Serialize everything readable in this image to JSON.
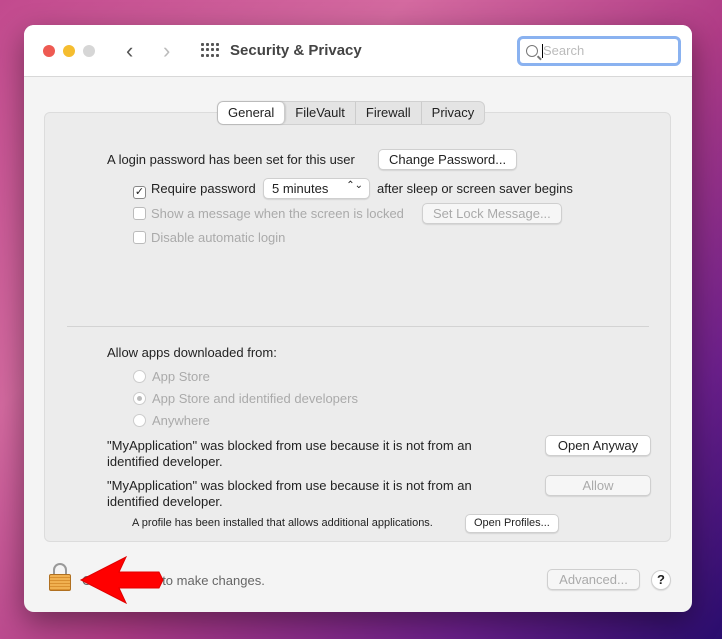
{
  "window": {
    "title": "Security & Privacy",
    "search_placeholder": "Search"
  },
  "tabs": [
    {
      "label": "General",
      "active": true
    },
    {
      "label": "FileVault"
    },
    {
      "label": "Firewall"
    },
    {
      "label": "Privacy"
    }
  ],
  "general": {
    "login_text": "A login password has been set for this user",
    "change_password": "Change Password...",
    "require_password": {
      "label": "Require password",
      "checked": true,
      "value": "5 minutes",
      "suffix": "after sleep or screen saver begins"
    },
    "show_message": {
      "label": "Show a message when the screen is locked",
      "checked": false,
      "button": "Set Lock Message..."
    },
    "disable_login": {
      "label": "Disable automatic login",
      "checked": false
    },
    "allow_apps_label": "Allow apps downloaded from:",
    "radios": [
      {
        "label": "App Store",
        "selected": false
      },
      {
        "label": "App Store and identified developers",
        "selected": true
      },
      {
        "label": "Anywhere",
        "selected": false
      }
    ],
    "blocked1": {
      "line1": "\"MyApplication\" was blocked from use because it is not from an",
      "line2": "identified developer.",
      "button": "Open Anyway"
    },
    "blocked2": {
      "line1": "\"MyApplication\" was blocked from use because it is not from an",
      "line2": "identified developer.",
      "button": "Allow"
    },
    "profile_text": "A profile has been installed that allows additional applications.",
    "open_profiles": "Open Profiles..."
  },
  "footer": {
    "lock_text": "Click the lock to make changes.",
    "advanced": "Advanced...",
    "help": "?"
  },
  "colors": {
    "annotation_arrow": "#ff0000",
    "focus_ring": "#8ab2f0"
  }
}
